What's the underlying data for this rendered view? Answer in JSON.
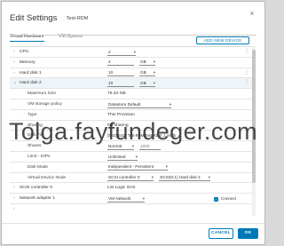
{
  "dialog": {
    "title": "Edit Settings",
    "vm_name": "Test-RDM",
    "close_glyph": "×",
    "tabs": [
      {
        "label": "Virtual Hardware",
        "active": true
      },
      {
        "label": "VM Options",
        "active": false
      }
    ],
    "add_device_label": "ADD NEW DEVICE"
  },
  "hardware": {
    "cpu": {
      "label": "CPU",
      "value": "2"
    },
    "memory": {
      "label": "Memory",
      "value": "4",
      "unit": "GB"
    },
    "hard_disk_1": {
      "label": "Hard disk 1",
      "value": "10",
      "unit": "GB"
    },
    "hard_disk_2": {
      "label": "Hard disk 2",
      "value": "10",
      "unit": "GB",
      "maximum_size": {
        "label": "Maximum Size",
        "value": "75.34 GB"
      },
      "vm_storage_policy": {
        "label": "VM storage policy",
        "value": "Datastore Default"
      },
      "type": {
        "label": "Type",
        "value": "Thin Provision"
      },
      "sharing": {
        "label": "Sharing",
        "value": "No sharing"
      },
      "disk_file": {
        "label": "Disk File",
        "value": "[SSD] ESXI Test-RDM/Test-RDM_1.vmdk"
      },
      "shares": {
        "label": "Shares",
        "value": "Normal",
        "number": "1000"
      },
      "limit_iops": {
        "label": "Limit - IOPs",
        "value": "Unlimited"
      },
      "disk_mode": {
        "label": "Disk Mode",
        "value": "Independent - Persistent"
      },
      "virtual_device_node": {
        "label": "Virtual Device Node",
        "controller": "SCSI controller 0",
        "node": "SCSI(0:1) Hard disk 2"
      }
    },
    "scsi_controller": {
      "label": "SCSI controller 0",
      "value": "LSI Logic SAS"
    },
    "network_adapter": {
      "label": "Network adapter 1",
      "value": "VM Network",
      "connect_label": "Connect"
    }
  },
  "footer": {
    "cancel_label": "CANCEL",
    "ok_label": "OK"
  },
  "watermark": {
    "text": "Tolga.fayfundeger.com"
  },
  "icons": {
    "caret_right": "›",
    "caret_down": "⌄",
    "remove": "⋮",
    "checkmark": "✓"
  },
  "colors": {
    "accent": "#0079b8",
    "expanded_row": "#eef4f8"
  }
}
